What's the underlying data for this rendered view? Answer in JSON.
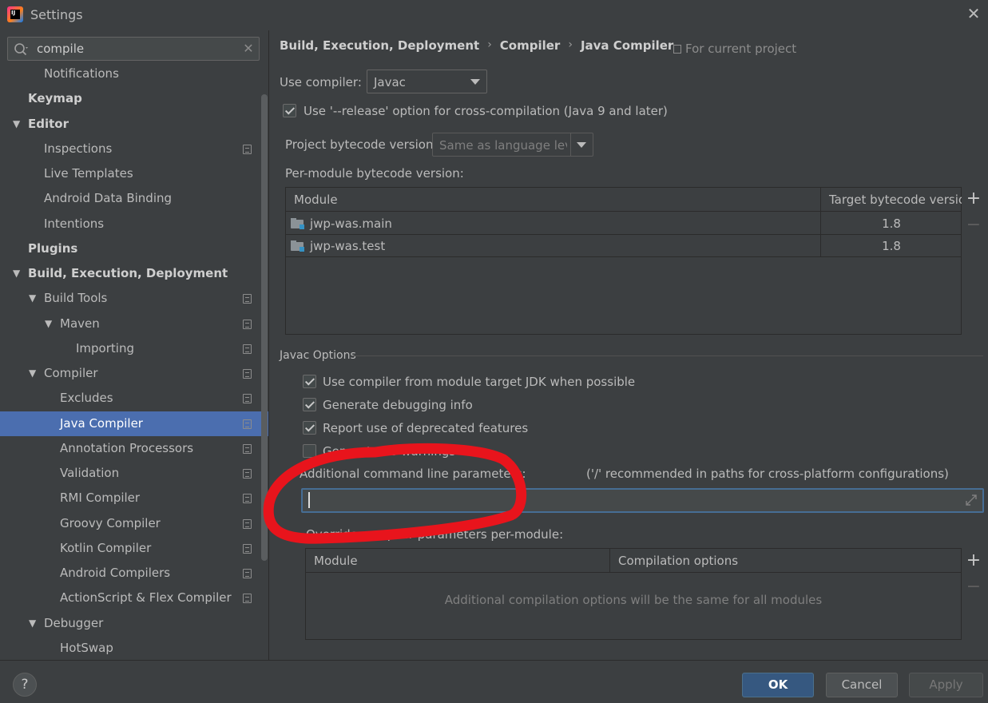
{
  "window": {
    "title": "Settings",
    "close": "✕"
  },
  "search": {
    "value": "compile",
    "clear": "✕"
  },
  "tree": [
    {
      "label": "Notifications",
      "level": 2,
      "bold": false,
      "expand": "none",
      "proj": false,
      "selected": false
    },
    {
      "label": "Keymap",
      "level": 1,
      "bold": true,
      "expand": "none",
      "proj": false,
      "selected": false
    },
    {
      "label": "Editor",
      "level": 1,
      "bold": true,
      "expand": "open",
      "proj": false,
      "selected": false
    },
    {
      "label": "Inspections",
      "level": 2,
      "bold": false,
      "expand": "none",
      "proj": true,
      "selected": false
    },
    {
      "label": "Live Templates",
      "level": 2,
      "bold": false,
      "expand": "none",
      "proj": false,
      "selected": false
    },
    {
      "label": "Android Data Binding",
      "level": 2,
      "bold": false,
      "expand": "none",
      "proj": false,
      "selected": false
    },
    {
      "label": "Intentions",
      "level": 2,
      "bold": false,
      "expand": "none",
      "proj": false,
      "selected": false
    },
    {
      "label": "Plugins",
      "level": 1,
      "bold": true,
      "expand": "none",
      "proj": false,
      "selected": false
    },
    {
      "label": "Build, Execution, Deployment",
      "level": 1,
      "bold": true,
      "expand": "open",
      "proj": false,
      "selected": false
    },
    {
      "label": "Build Tools",
      "level": 2,
      "bold": false,
      "expand": "open",
      "proj": true,
      "selected": false
    },
    {
      "label": "Maven",
      "level": 3,
      "bold": false,
      "expand": "open",
      "proj": true,
      "selected": false
    },
    {
      "label": "Importing",
      "level": 4,
      "bold": false,
      "expand": "none",
      "proj": true,
      "selected": false
    },
    {
      "label": "Compiler",
      "level": 2,
      "bold": false,
      "expand": "open",
      "proj": true,
      "selected": false
    },
    {
      "label": "Excludes",
      "level": 3,
      "bold": false,
      "expand": "none",
      "proj": true,
      "selected": false
    },
    {
      "label": "Java Compiler",
      "level": 3,
      "bold": false,
      "expand": "none",
      "proj": true,
      "selected": true
    },
    {
      "label": "Annotation Processors",
      "level": 3,
      "bold": false,
      "expand": "none",
      "proj": true,
      "selected": false
    },
    {
      "label": "Validation",
      "level": 3,
      "bold": false,
      "expand": "none",
      "proj": true,
      "selected": false
    },
    {
      "label": "RMI Compiler",
      "level": 3,
      "bold": false,
      "expand": "none",
      "proj": true,
      "selected": false
    },
    {
      "label": "Groovy Compiler",
      "level": 3,
      "bold": false,
      "expand": "none",
      "proj": true,
      "selected": false
    },
    {
      "label": "Kotlin Compiler",
      "level": 3,
      "bold": false,
      "expand": "none",
      "proj": true,
      "selected": false
    },
    {
      "label": "Android Compilers",
      "level": 3,
      "bold": false,
      "expand": "none",
      "proj": true,
      "selected": false
    },
    {
      "label": "ActionScript & Flex Compiler",
      "level": 3,
      "bold": false,
      "expand": "none",
      "proj": true,
      "selected": false
    },
    {
      "label": "Debugger",
      "level": 2,
      "bold": false,
      "expand": "open",
      "proj": false,
      "selected": false
    },
    {
      "label": "HotSwap",
      "level": 3,
      "bold": false,
      "expand": "none",
      "proj": false,
      "selected": false
    }
  ],
  "breadcrumb": {
    "items": [
      "Build, Execution, Deployment",
      "Compiler",
      "Java Compiler"
    ],
    "separator": "›"
  },
  "for_current_project": "For current project",
  "use_compiler": {
    "label": "Use compiler:",
    "value": "Javac"
  },
  "release_option": {
    "label": "Use '--release' option for cross-compilation (Java 9 and later)",
    "checked": true
  },
  "project_bytecode": {
    "label": "Project bytecode version:",
    "value": "Same as language level"
  },
  "per_module": {
    "label": "Per-module bytecode version:",
    "headers": [
      "Module",
      "Target bytecode version"
    ],
    "rows": [
      {
        "module": "jwp-was.main",
        "version": "1.8"
      },
      {
        "module": "jwp-was.test",
        "version": "1.8"
      }
    ],
    "add": "+",
    "remove": "−"
  },
  "javac_options": {
    "title": "Javac Options",
    "checkboxes": [
      {
        "label": "Use compiler from module target JDK when possible",
        "checked": true
      },
      {
        "label": "Generate debugging info",
        "checked": true
      },
      {
        "label": "Report use of deprecated features",
        "checked": true
      },
      {
        "label": "Generate no warnings",
        "checked": false
      }
    ],
    "additional_label": "Additional command line parameters:",
    "additional_hint": "('/' recommended in paths for cross-platform configurations)",
    "additional_value": "",
    "override_label": "Override compiler parameters per-module:",
    "override_headers": [
      "Module",
      "Compilation options"
    ],
    "override_empty": "Additional compilation options will be the same for all modules",
    "add": "+",
    "remove": "−"
  },
  "annotation_color": "#e8141c",
  "footer": {
    "help": "?",
    "ok": "OK",
    "cancel": "Cancel",
    "apply": "Apply"
  }
}
